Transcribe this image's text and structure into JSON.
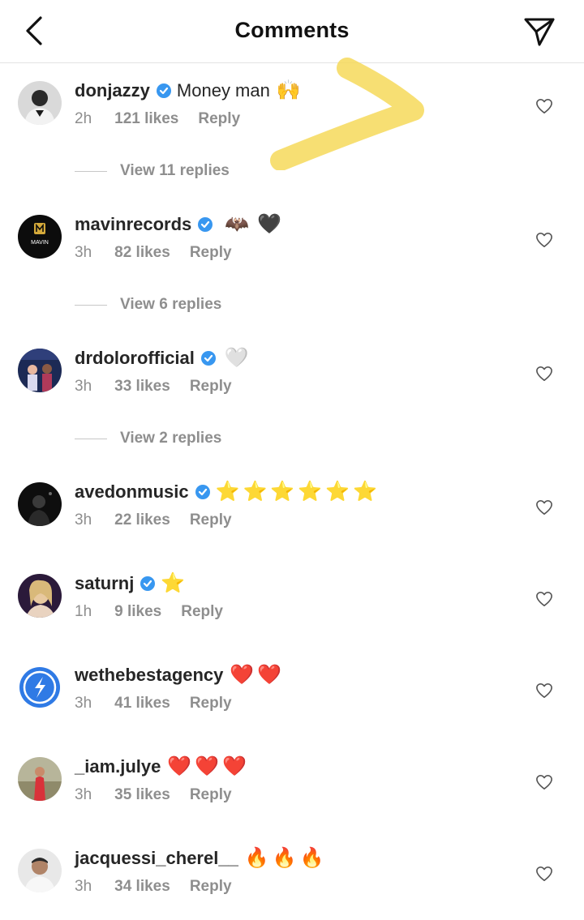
{
  "header": {
    "title": "Comments",
    "back_icon": "chevron-left-icon",
    "send_icon": "paper-plane-icon"
  },
  "colors": {
    "verified": "#3897f0",
    "muted": "#8e8e8e",
    "scribble": "#f6d95b"
  },
  "comments": [
    {
      "username": "donjazzy",
      "verified": true,
      "text": "Money man",
      "emojis": [
        "🙌"
      ],
      "time": "2h",
      "likes": "121 likes",
      "reply": "Reply",
      "view_replies": "View 11 replies"
    },
    {
      "username": "mavinrecords",
      "verified": true,
      "text": "",
      "emojis": [
        "🦇",
        "🖤"
      ],
      "time": "3h",
      "likes": "82 likes",
      "reply": "Reply",
      "view_replies": "View 6 replies",
      "avatar_text": "MAVIN"
    },
    {
      "username": "drdolorofficial",
      "verified": true,
      "text": "",
      "emojis": [
        "🤍"
      ],
      "time": "3h",
      "likes": "33 likes",
      "reply": "Reply",
      "view_replies": "View 2 replies"
    },
    {
      "username": "avedonmusic",
      "verified": true,
      "text": "",
      "emojis": [
        "⭐",
        "⭐",
        "⭐",
        "⭐",
        "⭐",
        "⭐"
      ],
      "time": "3h",
      "likes": "22 likes",
      "reply": "Reply"
    },
    {
      "username": "saturnj",
      "verified": true,
      "text": "",
      "emojis": [
        "⭐"
      ],
      "time": "1h",
      "likes": "9 likes",
      "reply": "Reply"
    },
    {
      "username": "wethebestagency",
      "verified": false,
      "text": "",
      "emojis": [
        "❤️",
        "❤️"
      ],
      "time": "3h",
      "likes": "41 likes",
      "reply": "Reply"
    },
    {
      "username": "_iam.julye",
      "verified": false,
      "text": "",
      "emojis": [
        "❤️",
        "❤️",
        "❤️"
      ],
      "time": "3h",
      "likes": "35 likes",
      "reply": "Reply"
    },
    {
      "username": "jacquessi_cherel__",
      "verified": false,
      "text": "",
      "emojis": [
        "🔥",
        "🔥",
        "🔥"
      ],
      "time": "3h",
      "likes": "34 likes",
      "reply": "Reply"
    }
  ]
}
